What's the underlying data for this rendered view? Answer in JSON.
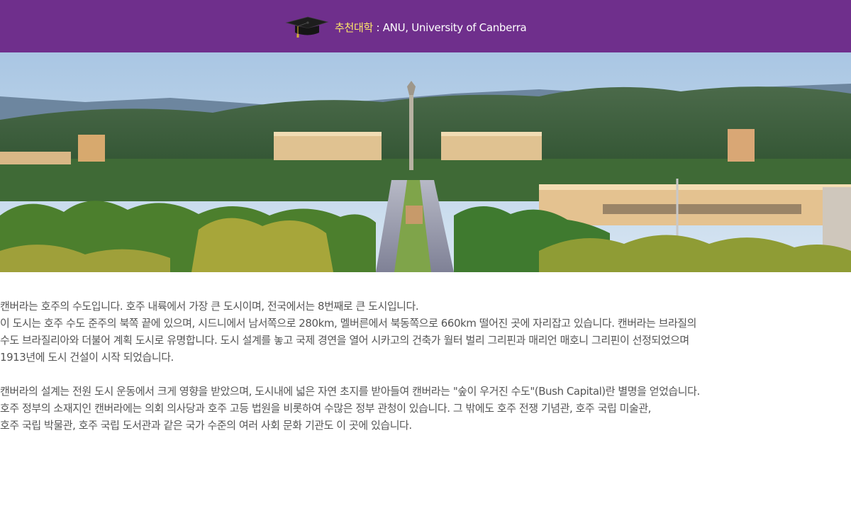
{
  "header": {
    "highlight": "추천대학",
    "rest": " : ANU, University of Canberra",
    "icon": "graduation-cap-icon",
    "background_color": "#6f2f8c",
    "highlight_color": "#ffe86a"
  },
  "hero": {
    "description": "Panoramic photo of Canberra city"
  },
  "body": {
    "paragraph1": [
      "캔버라는 호주의 수도입니다. 호주 내륙에서 가장 큰 도시이며, 전국에서는 8번째로 큰 도시입니다.",
      "이 도시는 호주 수도 준주의 북쪽 끝에 있으며, 시드니에서 남서쪽으로 280km, 멜버른에서 북동쪽으로 660km 떨어진 곳에 자리잡고 있습니다. 캔버라는 브라질의",
      "수도 브라질리아와 더불어 계획 도시로 유명합니다. 도시 설계를 놓고 국제 경연을 열어 시카고의 건축가 월터 벌리 그리핀과 매리언 매호니 그리핀이 선정되었으며",
      "1913년에 도시 건설이 시작 되었습니다."
    ],
    "paragraph2": [
      "캔버라의 설계는 전원 도시 운동에서 크게 영향을 받았으며, 도시내에 넓은 자연 초지를 받아들여 캔버라는 \"숲이 우거진 수도\"(Bush Capital)란 별명을 얻었습니다.",
      "호주 정부의 소재지인 캔버라에는 의회 의사당과 호주 고등 법원을 비롯하여 수많은 정부 관청이 있습니다. 그 밖에도 호주 전쟁 기념관, 호주 국립 미술관,",
      "호주 국립 박물관, 호주 국립 도서관과 같은 국가 수준의 여러 사회 문화 기관도 이 곳에 있습니다."
    ]
  }
}
